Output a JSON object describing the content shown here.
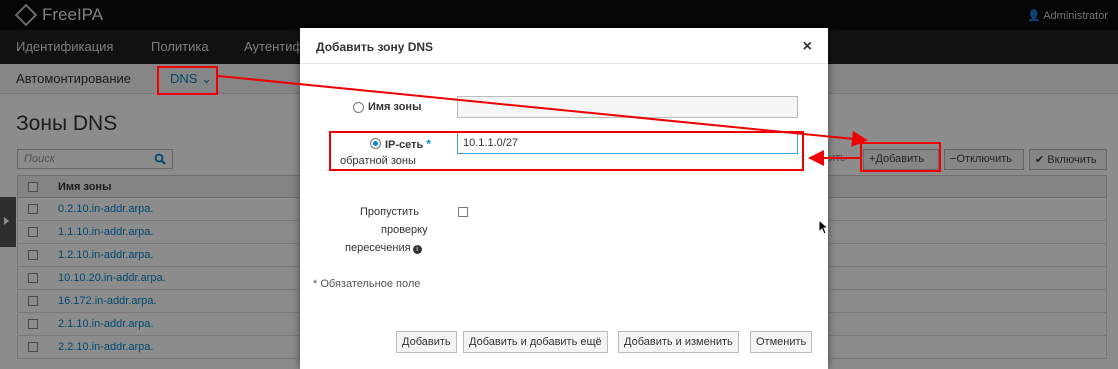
{
  "header": {
    "brand": "FreeIPA",
    "user": "Administrator"
  },
  "nav": {
    "items": [
      "Идентификация",
      "Политика",
      "Аутентиф"
    ]
  },
  "subnav": {
    "automount": "Автомонтирование",
    "dns": "DNS"
  },
  "page": {
    "title": "Зоны DNS",
    "search_placeholder": "Поиск",
    "toolbar": {
      "add": "Добавить",
      "disable": "Отключить",
      "enable": "Включить",
      "partial": "ить"
    },
    "table": {
      "column": "Имя зоны",
      "rows": [
        "0.2.10.in-addr.arpa.",
        "1.1.10.in-addr.arpa.",
        "1.2.10.in-addr.arpa.",
        "10.10.20.in-addr.arpa.",
        "16.172.in-addr.arpa.",
        "2.1.10.in-addr.arpa.",
        "2.2.10.in-addr.arpa."
      ]
    }
  },
  "modal": {
    "title": "Добавить зону DNS",
    "close": "×",
    "zone_name_label": "Имя зоны",
    "zone_name_value": "",
    "ip_network_label": "IP-сеть",
    "ip_network_label2": "обратной зоны",
    "required_mark": "*",
    "ip_network_value": "10.1.1.0/27",
    "skip_label_1": "Пропустить",
    "skip_label_2": "проверку",
    "skip_label_3": "пересечения",
    "required_note": "* Обязательное поле",
    "buttons": {
      "add": "Добавить",
      "add_another": "Добавить и добавить ещё",
      "add_edit": "Добавить и изменить",
      "cancel": "Отменить"
    }
  },
  "colors": {
    "accent": "#0088ce",
    "annotation": "#e00000"
  }
}
